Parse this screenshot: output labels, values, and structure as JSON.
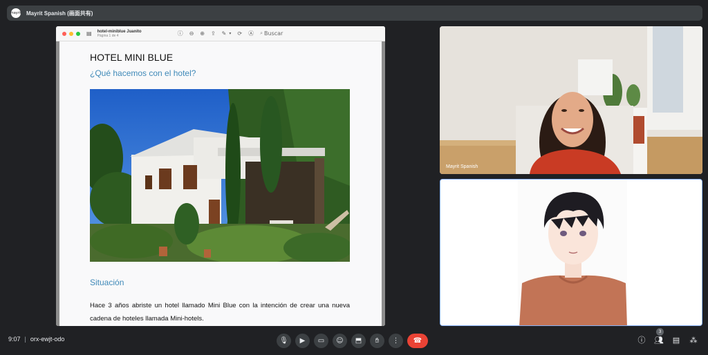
{
  "presenter_bar": {
    "logo_text": "mayrit",
    "title": "Mayrit Spanish (画面共有)"
  },
  "preview": {
    "document_name": "hotel-miniblue Juanito",
    "page_indicator": "Página 1 de 4",
    "search_placeholder": "Buscar",
    "icons": [
      "sidebar-icon",
      "info-icon",
      "zoom-out-icon",
      "zoom-in-icon",
      "share-icon",
      "markup-pen-icon",
      "rotate-icon",
      "annotate-icon",
      "search-icon"
    ]
  },
  "document": {
    "title": "HOTEL MINI BLUE",
    "subtitle": "¿Qué hacemos con el hotel?",
    "section_heading": "Situación",
    "paragraph": "Hace 3 años abriste un hotel llamado Mini Blue con la intención de crear una nueva cadena de hoteles llamada Mini-hotels."
  },
  "participants": [
    {
      "name": "Mayrit Spanish",
      "kind": "camera"
    },
    {
      "name": "",
      "kind": "avatar"
    }
  ],
  "meeting": {
    "time": "9:07",
    "code": "orx-ewjt-odo",
    "participant_count": "3"
  },
  "colors": {
    "background": "#202124",
    "doc_accent": "#3f89b8",
    "end_call": "#ea4335"
  }
}
